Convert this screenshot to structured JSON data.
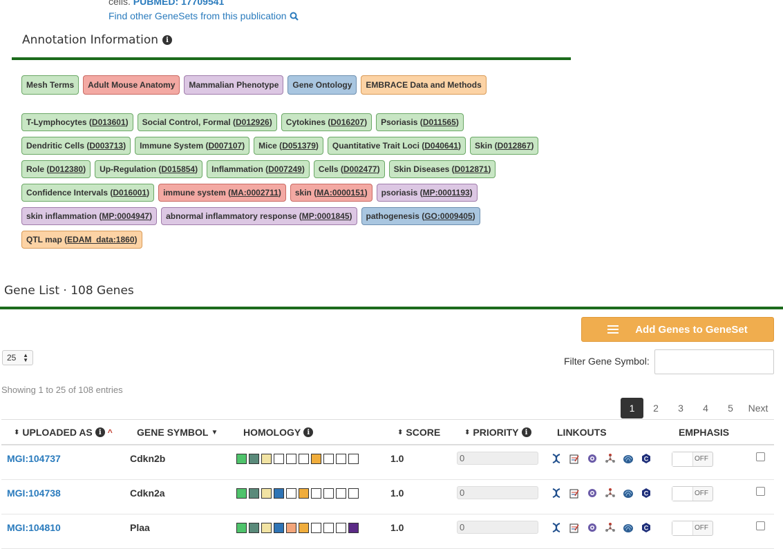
{
  "publication": {
    "cells_text": "cells.",
    "pubmed_label": "PUBMED: 17709541",
    "find_other_link": "Find other GeneSets from this publication"
  },
  "annotation": {
    "title": "Annotation Information",
    "legend": [
      {
        "label": "Mesh Terms",
        "class": "c-mesh"
      },
      {
        "label": "Adult Mouse Anatomy",
        "class": "c-ma"
      },
      {
        "label": "Mammalian Phenotype",
        "class": "c-mp"
      },
      {
        "label": "Gene Ontology",
        "class": "c-go"
      },
      {
        "label": "EMBRACE Data and Methods",
        "class": "c-edam"
      }
    ],
    "rows": [
      [
        {
          "name": "T-Lymphocytes",
          "id": "D013601",
          "class": "c-mesh"
        },
        {
          "name": "Social Control, Formal",
          "id": "D012926",
          "class": "c-mesh"
        },
        {
          "name": "Cytokines",
          "id": "D016207",
          "class": "c-mesh"
        },
        {
          "name": "Psoriasis",
          "id": "D011565",
          "class": "c-mesh"
        }
      ],
      [
        {
          "name": "Dendritic Cells",
          "id": "D003713",
          "class": "c-mesh"
        },
        {
          "name": "Immune System",
          "id": "D007107",
          "class": "c-mesh"
        },
        {
          "name": "Mice",
          "id": "D051379",
          "class": "c-mesh"
        },
        {
          "name": "Quantitative Trait Loci",
          "id": "D040641",
          "class": "c-mesh"
        },
        {
          "name": "Skin",
          "id": "D012867",
          "class": "c-mesh"
        }
      ],
      [
        {
          "name": "Role",
          "id": "D012380",
          "class": "c-mesh"
        },
        {
          "name": "Up-Regulation",
          "id": "D015854",
          "class": "c-mesh"
        },
        {
          "name": "Inflammation",
          "id": "D007249",
          "class": "c-mesh"
        },
        {
          "name": "Cells",
          "id": "D002477",
          "class": "c-mesh"
        },
        {
          "name": "Skin Diseases",
          "id": "D012871",
          "class": "c-mesh"
        }
      ],
      [
        {
          "name": "Confidence Intervals",
          "id": "D016001",
          "class": "c-mesh"
        },
        {
          "name": "immune system",
          "id": "MA:0002711",
          "class": "c-ma"
        },
        {
          "name": "skin",
          "id": "MA:0000151",
          "class": "c-ma"
        },
        {
          "name": "psoriasis",
          "id": "MP:0001193",
          "class": "c-mp"
        }
      ],
      [
        {
          "name": "skin inflammation",
          "id": "MP:0004947",
          "class": "c-mp"
        },
        {
          "name": "abnormal inflammatory response",
          "id": "MP:0001845",
          "class": "c-mp"
        },
        {
          "name": "pathogenesis",
          "id": "GO:0009405",
          "class": "c-go"
        }
      ],
      [
        {
          "name": "QTL map",
          "id": "EDAM_data:1860",
          "class": "c-edam"
        }
      ]
    ]
  },
  "gene_list": {
    "title": "Gene List · 108 Genes",
    "add_button": "Add Genes to GeneSet",
    "page_size": "25",
    "filter_label": "Filter Gene Symbol:",
    "filter_value": "",
    "showing": "Showing 1 to 25 of 108 entries",
    "pager": [
      "1",
      "2",
      "3",
      "4",
      "5"
    ],
    "pager_active": "1",
    "next_label": "Next",
    "columns": {
      "uploaded_as": "UPLOADED AS",
      "gene_symbol": "GENE SYMBOL",
      "homology": "HOMOLOGY",
      "score": "SCORE",
      "priority": "PRIORITY",
      "linkouts": "LINKOUTS",
      "emphasis": "EMPHASIS"
    },
    "homology_palette": [
      "#4fc36b",
      "#5a8a7a",
      "#f1e3a3",
      "#2f74b5",
      "#f3a57a",
      "#f0ad3c",
      "#ffffff",
      "#ffffff",
      "#ffffff",
      "#5b2a86"
    ],
    "rows": [
      {
        "uploaded_as": "MGI:104737",
        "symbol": "Cdkn2b",
        "score": "1.0",
        "priority": "0",
        "toggle": "OFF",
        "homology": [
          "#4fc36b",
          "#5a8a7a",
          "#f1e3a3",
          "#ffffff",
          "#ffffff",
          "#ffffff",
          "#f0ad3c",
          "#ffffff",
          "#ffffff",
          "#ffffff",
          "#5b2a86"
        ]
      },
      {
        "uploaded_as": "MGI:104738",
        "symbol": "Cdkn2a",
        "score": "1.0",
        "priority": "0",
        "toggle": "OFF",
        "homology": [
          "#4fc36b",
          "#5a8a7a",
          "#f1e3a3",
          "#2f74b5",
          "#ffffff",
          "#f0ad3c",
          "#ffffff",
          "#ffffff",
          "#ffffff",
          "#ffffff"
        ]
      },
      {
        "uploaded_as": "MGI:104810",
        "symbol": "Plaa",
        "score": "1.0",
        "priority": "0",
        "toggle": "OFF",
        "homology": [
          "#4fc36b",
          "#5a8a7a",
          "#f1e3a3",
          "#2f74b5",
          "#f3a57a",
          "#f0ad3c",
          "#ffffff",
          "#ffffff",
          "#ffffff",
          "#5b2a86"
        ]
      }
    ],
    "linkout_icons": [
      "dna-icon",
      "notepad-icon",
      "gear-flower-icon",
      "network-icon",
      "shell-icon",
      "c-logo-icon"
    ]
  }
}
